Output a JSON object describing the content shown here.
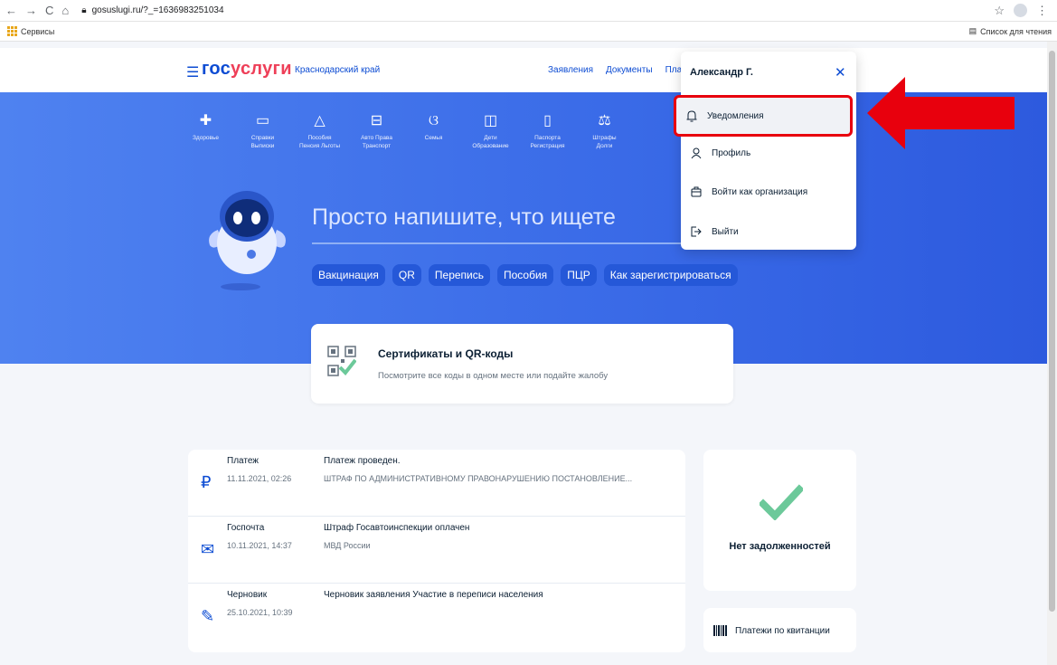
{
  "browser": {
    "url": "gosuslugi.ru/?_=1636983251034",
    "bookmarks_label": "Сервисы",
    "reading_list": "Список для чтения"
  },
  "header": {
    "logo_part1": "гос",
    "logo_part2": "услуги",
    "region": "Краснодарский край",
    "nav": [
      "Заявления",
      "Документы",
      "Платеж"
    ]
  },
  "categories": [
    {
      "icon": "plus-shield-icon",
      "label": "Здоровье"
    },
    {
      "icon": "folder-icon",
      "label": "Справки\nВыписки"
    },
    {
      "icon": "hand-icon",
      "label": "Пособия\nПенсия Льготы"
    },
    {
      "icon": "car-icon",
      "label": "Авто Права\nТранспорт"
    },
    {
      "icon": "stroller-icon",
      "label": "Семья"
    },
    {
      "icon": "book-icon",
      "label": "Дети\nОбразование"
    },
    {
      "icon": "passport-icon",
      "label": "Паспорта\nРегистрация"
    },
    {
      "icon": "gavel-icon",
      "label": "Штрафы\nДолги"
    }
  ],
  "search": {
    "placeholder": "Просто напишите, что ищете",
    "chips": [
      "Вакцинация",
      "QR",
      "Перепись",
      "Пособия",
      "ПЦР",
      "Как зарегистрироваться"
    ]
  },
  "certificates": {
    "title": "Сертификаты и QR-коды",
    "subtitle": "Посмотрите все коды в одном месте или подайте жалобу"
  },
  "feed": [
    {
      "icon": "ruble-icon",
      "kind": "Платеж",
      "date": "11.11.2021, 02:26",
      "headline": "Платеж проведен.",
      "sub": "ШТРАФ ПО АДМИНИСТРАТИВНОМУ ПРАВОНАРУШЕНИЮ ПОСТАНОВЛЕНИЕ..."
    },
    {
      "icon": "envelope-icon",
      "kind": "Госпочта",
      "date": "10.11.2021, 14:37",
      "headline": "Штраф Госавтоинспекции оплачен",
      "sub": "МВД России"
    },
    {
      "icon": "pencil-icon",
      "kind": "Черновик",
      "date": "25.10.2021, 10:39",
      "headline": "Черновик заявления Участие в переписи населения",
      "sub": ""
    }
  ],
  "debt": {
    "text": "Нет задолженностей",
    "accent": "#6cc99a"
  },
  "receipt": {
    "text": "Платежи по квитанции"
  },
  "dropdown": {
    "user": "Александр Г.",
    "items": [
      {
        "icon": "bell-icon",
        "label": "Уведомления",
        "highlighted": true
      },
      {
        "icon": "person-icon",
        "label": "Профиль"
      },
      {
        "icon": "briefcase-icon",
        "label": "Войти как организация"
      },
      {
        "icon": "logout-icon",
        "label": "Выйти"
      }
    ]
  },
  "colors": {
    "brand_blue": "#0d4cd3",
    "brand_red": "#ee3f58",
    "highlight": "#e8000d"
  }
}
